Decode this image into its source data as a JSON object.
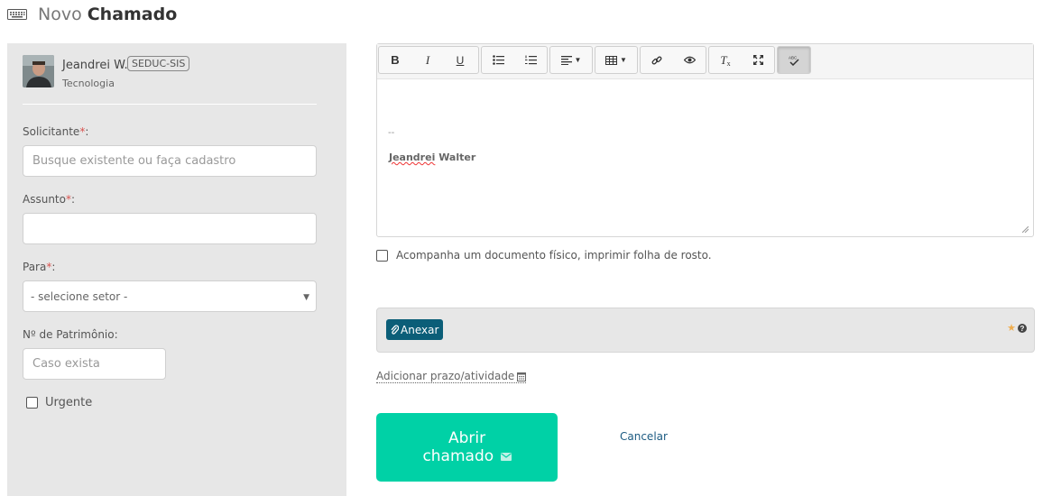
{
  "header": {
    "icon": "keyboard-icon",
    "title_prefix": "Novo",
    "title_main": "Chamado"
  },
  "user": {
    "name": "Jeandrei W.",
    "badge": "SEDUC-SIS",
    "department": "Tecnologia"
  },
  "form": {
    "solicitante_label": "Solicitante",
    "solicitante_placeholder": "Busque existente ou faça cadastro",
    "assunto_label": "Assunto",
    "assunto_value": "",
    "para_label": "Para",
    "para_selected": "- selecione setor -",
    "patrimonio_label": "Nº de Patrimônio:",
    "patrimonio_placeholder": "Caso exista",
    "urgente_label": "Urgente",
    "required_mark": "*",
    "colon": ":"
  },
  "editor": {
    "toolbar_icons": [
      "bold-icon",
      "italic-icon",
      "underline-icon",
      "bullet-list-icon",
      "numbered-list-icon",
      "align-icon",
      "table-icon",
      "link-icon",
      "preview-icon",
      "remove-format-icon",
      "fullscreen-icon",
      "spellcheck-icon"
    ],
    "signature_dash": "--",
    "signature_name_first": "Jeandrei",
    "signature_name_last": "Walter"
  },
  "document_check_label": "Acompanha um documento físico, imprimir folha de rosto.",
  "attach": {
    "button_label": "Anexar"
  },
  "deadline_link": "Adicionar prazo/atividade",
  "actions": {
    "submit_line1": "Abrir",
    "submit_line2": "chamado",
    "cancel": "Cancelar"
  },
  "colors": {
    "accent": "#00d1a6",
    "attach_button": "#0b5e78",
    "panel_bg": "#e7e7e7",
    "required": "#d9534f",
    "link": "#1c5b82"
  }
}
